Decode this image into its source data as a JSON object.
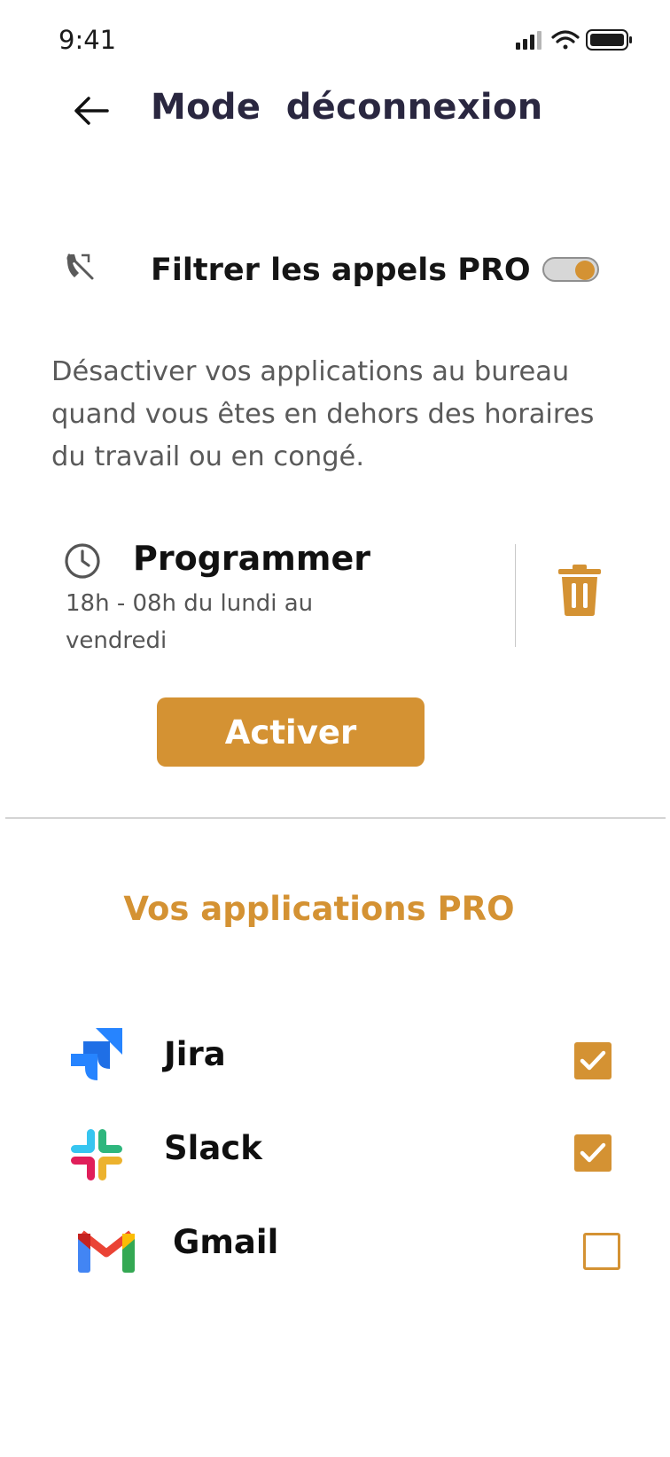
{
  "status_bar": {
    "time": "9:41"
  },
  "header": {
    "title": "Mode  déconnexion"
  },
  "filter": {
    "label": "Filtrer les appels PRO",
    "enabled": true
  },
  "description": "Désactiver vos applications au bureau quand vous êtes en dehors des horaires du travail ou en congé.",
  "schedule": {
    "title": "Programmer",
    "time": "18h - 08h du lundi au vendredi"
  },
  "activate_label": "Activer",
  "apps_section": {
    "title": "Vos applications PRO",
    "apps": [
      {
        "name": "Jira",
        "icon": "jira-logo-icon",
        "checked": true
      },
      {
        "name": "Slack",
        "icon": "slack-logo-icon",
        "checked": true
      },
      {
        "name": "Gmail",
        "icon": "gmail-logo-icon",
        "checked": false
      }
    ]
  },
  "colors": {
    "accent": "#d49233",
    "title": "#2a2740"
  }
}
